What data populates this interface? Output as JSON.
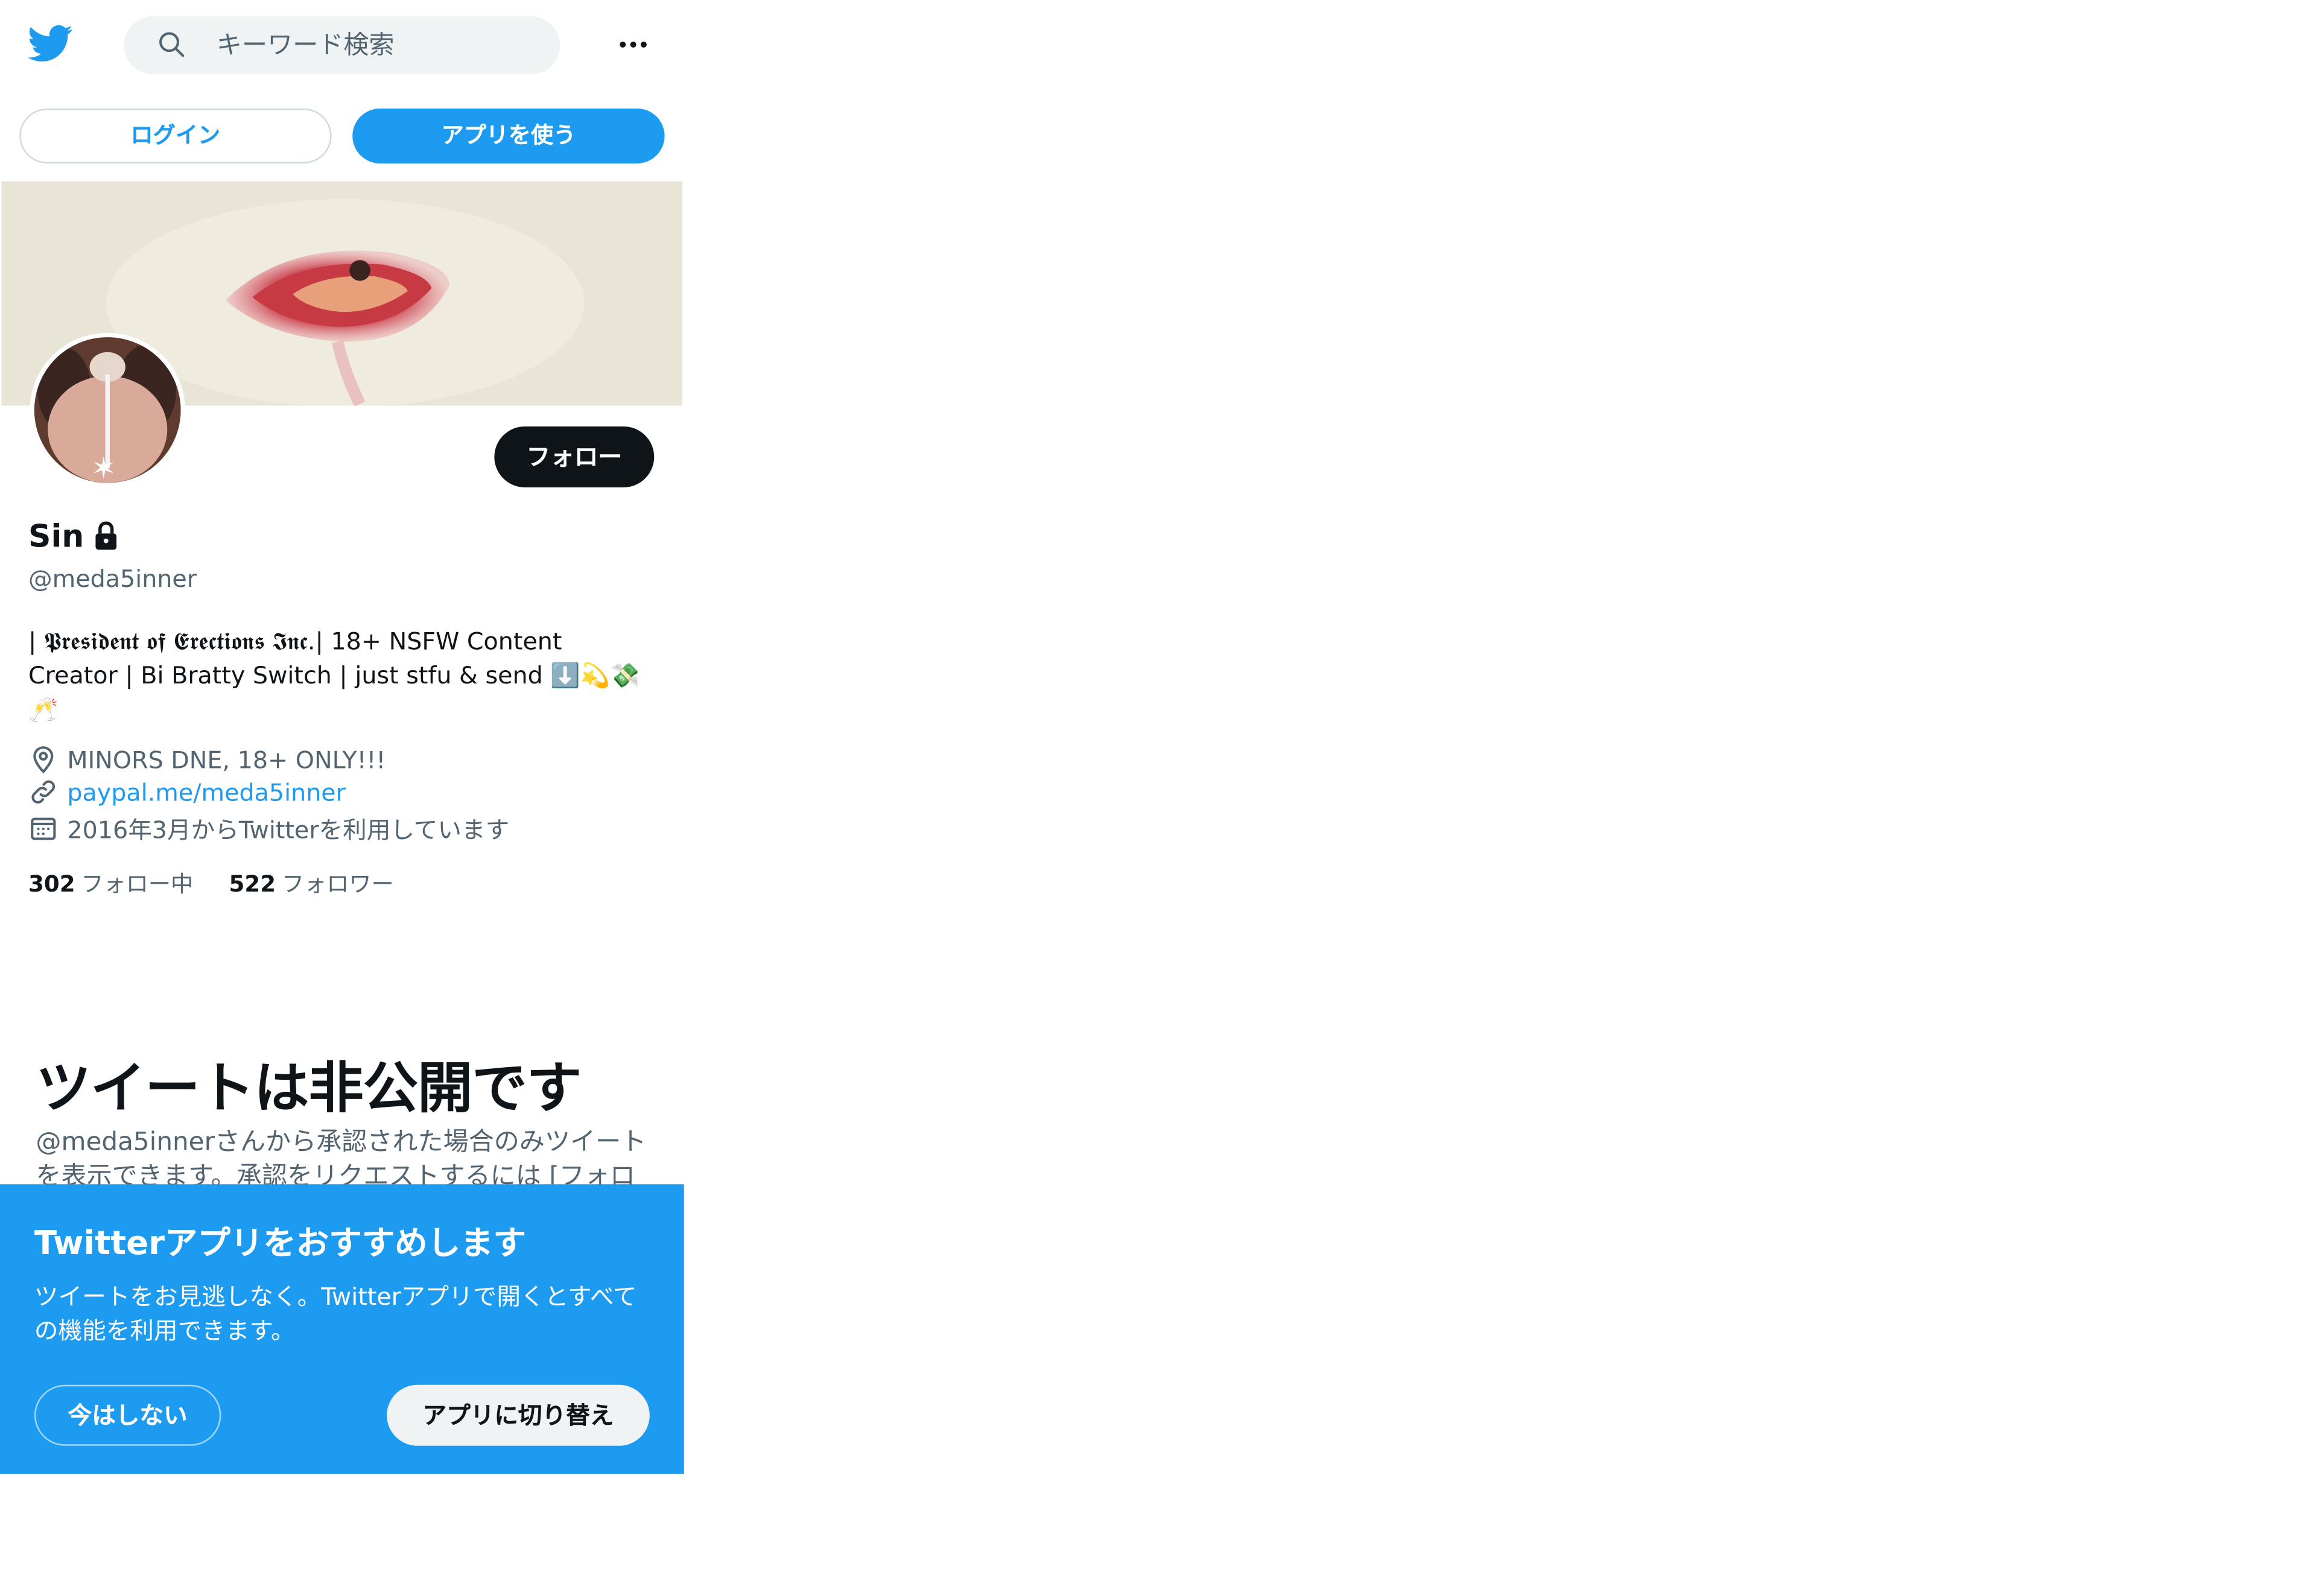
{
  "header": {
    "logo_icon": "twitter-bird-icon",
    "search": {
      "placeholder": "キーワード検索",
      "icon": "search-icon"
    },
    "more_icon": "more-dots-icon"
  },
  "auth": {
    "login_label": "ログイン",
    "use_app_label": "アプリを使う"
  },
  "profile": {
    "display_name": "Sin",
    "protected_icon": "lock-icon",
    "handle": "@meda5inner",
    "follow_label": "フォロー",
    "bio_line1": "| 𝕻𝖗𝖊𝖘𝖎𝖉𝖊𝖓𝖙 𝖔𝖋 𝕰𝖗𝖊𝖈𝖙𝖎𝖔𝖓𝖘 𝕴𝖓𝖈.| 18+ NSFW Content",
    "bio_line2": "Creator | Bi Bratty Switch | just stfu & send ⬇️💫💸",
    "bio_line3": "🥂",
    "location": "MINORS DNE, 18+ ONLY!!!",
    "url": "paypal.me/meda5inner",
    "joined": "2016年3月からTwitterを利用しています",
    "following_count": "302",
    "following_label": "フォロー中",
    "followers_count": "522",
    "followers_label": "フォロワー"
  },
  "private_notice": {
    "title": "ツイートは非公開です",
    "description": "@meda5innerさんから承認された場合のみツイートを表示できます。承認をリクエストするには [フォロ"
  },
  "app_prompt": {
    "title": "Twitterアプリをおすすめします",
    "description": "ツイートをお見逃しなく。Twitterアプリで開くとすべての機能を利用できます。",
    "not_now_label": "今はしない",
    "switch_label": "アプリに切り替え"
  },
  "colors": {
    "accent": "#1d9bf0",
    "text": "#0f1419",
    "secondary": "#536471"
  }
}
